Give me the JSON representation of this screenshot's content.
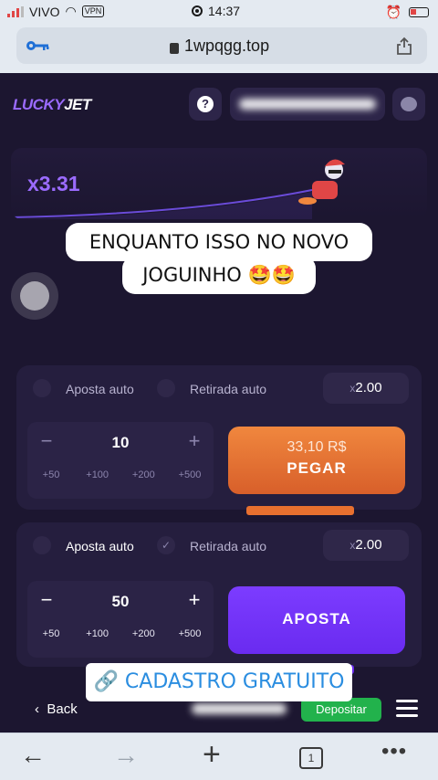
{
  "status_bar": {
    "carrier": "VIVO",
    "vpn": "VPN",
    "time": "14:37"
  },
  "browser": {
    "url": "1wpqgg.top",
    "tab_count": "1"
  },
  "app": {
    "logo_part1": "LUCKY",
    "logo_part2": "JET",
    "help_icon": "?",
    "game": {
      "multiplier": "x3.31"
    },
    "overlay": {
      "line1": "ENQUANTO ISSO NO NOVO",
      "line2": "JOGUINHO 🤩🤩",
      "cta": "CADASTRO GRATUITO"
    },
    "panel1": {
      "auto_bet_label": "Aposta auto",
      "auto_cashout_label": "Retirada auto",
      "cashout_multiplier": "2.00",
      "x_prefix": "x",
      "minus": "−",
      "plus": "+",
      "stake": "10",
      "quick_amounts": [
        "+50",
        "+100",
        "+200",
        "+500"
      ],
      "button_amount": "33,10 R$",
      "button_label": "PEGAR"
    },
    "panel2": {
      "auto_bet_label": "Aposta auto",
      "auto_cashout_label": "Retirada auto",
      "cashout_multiplier": "2.00",
      "x_prefix": "x",
      "minus": "−",
      "plus": "+",
      "stake": "50",
      "quick_amounts": [
        "+50",
        "+100",
        "+200",
        "+500"
      ],
      "button_label": "APOSTA"
    },
    "bottom": {
      "back_label": "Back",
      "deposit_label": "Depositar"
    }
  },
  "colors": {
    "accent": "#7c3cff",
    "orange": "#e8702f",
    "green": "#22b24c",
    "background": "#1c1630"
  }
}
